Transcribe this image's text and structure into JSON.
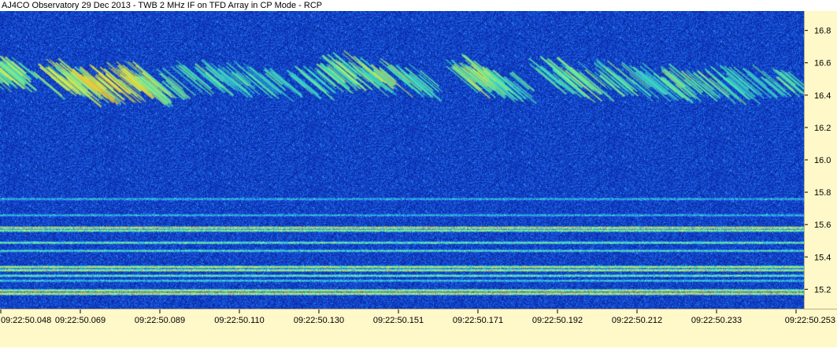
{
  "title": "AJ4CO Observatory 29 Dec 2013 - TWB 2 MHz IF on TFD Array in CP Mode - RCP",
  "chart_data": {
    "type": "heatmap",
    "title": "AJ4CO Observatory 29 Dec 2013 - TWB 2 MHz IF on TFD Array in CP Mode - RCP",
    "xlabel": "",
    "ylabel": "",
    "x_ticks": [
      "09:22:50.048",
      "09:22:50.069",
      "09:22:50.089",
      "09:22:50.110",
      "09:22:50.130",
      "09:22:50.151",
      "09:22:50.171",
      "09:22:50.192",
      "09:22:50.212",
      "09:22:50.233",
      "09:22:50.253"
    ],
    "x_range_seconds": [
      50.048,
      50.253
    ],
    "y_ticks": [
      15.2,
      15.4,
      15.6,
      15.8,
      16.0,
      16.2,
      16.4,
      16.6,
      16.8
    ],
    "y_tick_labels": [
      "15.2",
      "15.4",
      "15.6",
      "15.8",
      "16.0",
      "16.2",
      "16.4",
      "16.6",
      "16.8"
    ],
    "ylim": [
      15.08,
      16.92
    ],
    "y_scale": "linear",
    "grid": false,
    "colormap": [
      "#08167a",
      "#0a2fb4",
      "#1e64e6",
      "#2fb4e6",
      "#46e6b4",
      "#dcf050",
      "#f0c832",
      "#ff5a32"
    ],
    "background_color": "#0a2a9c",
    "axis_panel_color": "#fff8c8",
    "emission_bursts": [
      {
        "t": 50.048,
        "f": 16.54,
        "intensity": 0.7
      },
      {
        "t": 50.052,
        "f": 16.53,
        "intensity": 0.65
      },
      {
        "t": 50.063,
        "f": 16.5,
        "intensity": 0.8
      },
      {
        "t": 50.068,
        "f": 16.48,
        "intensity": 0.85
      },
      {
        "t": 50.073,
        "f": 16.46,
        "intensity": 1.0
      },
      {
        "t": 50.079,
        "f": 16.47,
        "intensity": 0.95
      },
      {
        "t": 50.085,
        "f": 16.49,
        "intensity": 0.9
      },
      {
        "t": 50.09,
        "f": 16.45,
        "intensity": 0.7
      },
      {
        "t": 50.1,
        "f": 16.52,
        "intensity": 0.55
      },
      {
        "t": 50.108,
        "f": 16.5,
        "intensity": 0.5
      },
      {
        "t": 50.118,
        "f": 16.48,
        "intensity": 0.45
      },
      {
        "t": 50.128,
        "f": 16.47,
        "intensity": 0.5
      },
      {
        "t": 50.135,
        "f": 16.52,
        "intensity": 0.6
      },
      {
        "t": 50.14,
        "f": 16.55,
        "intensity": 0.65
      },
      {
        "t": 50.147,
        "f": 16.51,
        "intensity": 0.65
      },
      {
        "t": 50.155,
        "f": 16.47,
        "intensity": 0.5
      },
      {
        "t": 50.17,
        "f": 16.54,
        "intensity": 0.7
      },
      {
        "t": 50.174,
        "f": 16.48,
        "intensity": 0.75
      },
      {
        "t": 50.18,
        "f": 16.45,
        "intensity": 0.5
      },
      {
        "t": 50.192,
        "f": 16.52,
        "intensity": 0.6
      },
      {
        "t": 50.198,
        "f": 16.48,
        "intensity": 0.6
      },
      {
        "t": 50.208,
        "f": 16.5,
        "intensity": 0.55
      },
      {
        "t": 50.216,
        "f": 16.47,
        "intensity": 0.45
      },
      {
        "t": 50.224,
        "f": 16.47,
        "intensity": 0.65
      },
      {
        "t": 50.232,
        "f": 16.46,
        "intensity": 0.55
      },
      {
        "t": 50.241,
        "f": 16.47,
        "intensity": 0.45
      },
      {
        "t": 50.25,
        "f": 16.47,
        "intensity": 0.5
      }
    ],
    "interference_lines": [
      {
        "f": 15.76,
        "intensity": 0.35
      },
      {
        "f": 15.66,
        "intensity": 0.35
      },
      {
        "f": 15.582,
        "intensity": 0.95
      },
      {
        "f": 15.565,
        "intensity": 0.7
      },
      {
        "f": 15.49,
        "intensity": 0.6
      },
      {
        "f": 15.44,
        "intensity": 0.5
      },
      {
        "f": 15.34,
        "intensity": 0.8
      },
      {
        "f": 15.32,
        "intensity": 0.85
      },
      {
        "f": 15.286,
        "intensity": 0.6
      },
      {
        "f": 15.255,
        "intensity": 0.4
      },
      {
        "f": 15.195,
        "intensity": 0.85
      },
      {
        "f": 15.175,
        "intensity": 1.0
      }
    ]
  }
}
